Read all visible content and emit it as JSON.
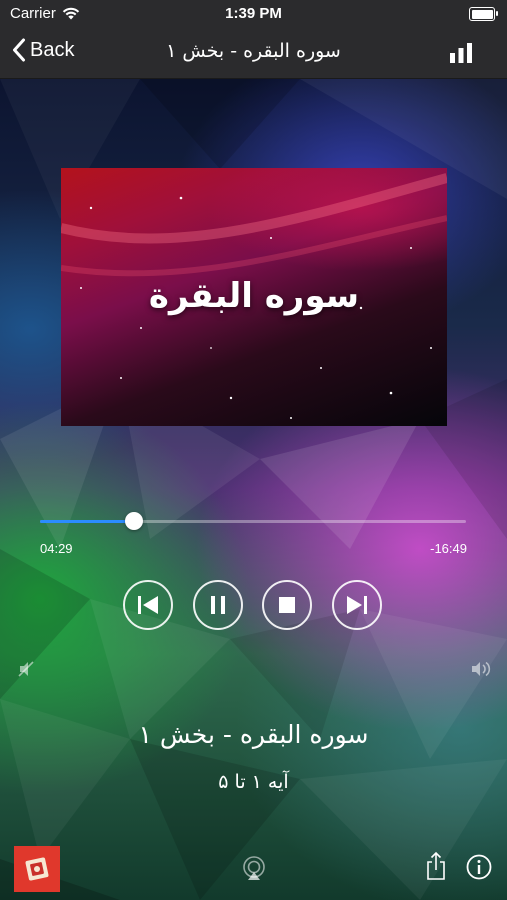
{
  "status_bar": {
    "carrier": "Carrier",
    "time": "1:39 PM"
  },
  "nav": {
    "back_label": "Back",
    "title": "سوره البقره - بخش ۱"
  },
  "artwork": {
    "title": "سوره البقرة"
  },
  "player": {
    "elapsed": "04:29",
    "remaining": "-16:49",
    "progress": 0.22
  },
  "track": {
    "title": "سوره البقره - بخش ۱",
    "subtitle": "آیه ۱ تا ۵"
  },
  "colors": {
    "accent": "#2b8cff",
    "app_icon": "#e0382c",
    "nav_bg": "#2b2b2d"
  },
  "icons": [
    "wifi-icon",
    "battery-icon",
    "chevron-left-icon",
    "bar-chart-icon",
    "previous-icon",
    "pause-icon",
    "stop-icon",
    "next-icon",
    "volume-min-icon",
    "volume-max-icon",
    "book-icon",
    "airplay-icon",
    "share-icon",
    "info-icon"
  ]
}
